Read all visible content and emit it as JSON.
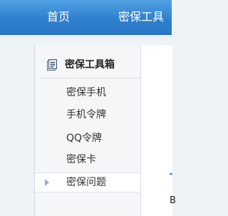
{
  "top_nav": {
    "home_label": "首页",
    "tools_label": "密保工具"
  },
  "sidebar": {
    "title": "密保工具箱",
    "icon": "toolbox-icon",
    "items": [
      {
        "label": "密保手机",
        "active": false
      },
      {
        "label": "手机令牌",
        "active": false
      },
      {
        "label": "QQ令牌",
        "active": false
      },
      {
        "label": "密保卡",
        "active": false
      },
      {
        "label": "密保问题",
        "active": true
      }
    ]
  },
  "content": {
    "edge_text": "B"
  },
  "colors": {
    "nav_bar": "#2f80cf",
    "nav_text": "#ffffff",
    "sidebar_bg": "#f4f6f8",
    "active_item_bg": "#ffffff",
    "active_arrow": "#8fb3d6"
  }
}
